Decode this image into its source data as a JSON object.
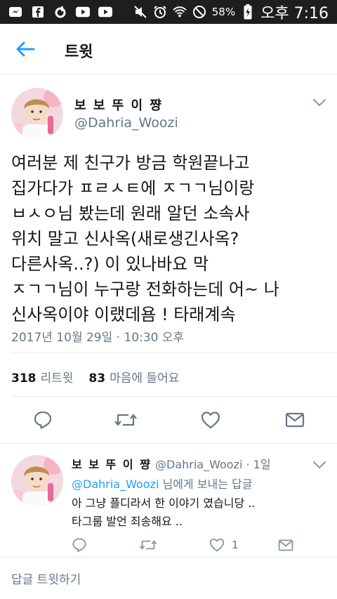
{
  "status_bar": {
    "battery_percent": "58%",
    "time": "오후 7:16",
    "left_icons": [
      "messenger-icon",
      "facebook-icon",
      "kakaostory-icon",
      "youtube-icon",
      "youtube-icon"
    ],
    "right_icons": [
      "mute-icon",
      "alarm-icon",
      "wifi-icon",
      "do-not-disturb-icon",
      "battery-charging-icon"
    ]
  },
  "app_bar": {
    "title": "트윗",
    "back_icon": "arrow-left-icon"
  },
  "main_tweet": {
    "display_name": "보 보 뚜 이 쨩",
    "handle": "@Dahria_Woozi",
    "text_lines": [
      "여러분 제 친구가 방금 학원끝나고",
      "집가다가 ㅍㄹㅅㅌ에 ㅈㄱㄱ님이랑",
      "ㅂㅅㅇ님 봤는데 원래 알던 소속사",
      "위치 말고 신사옥(새로생긴사옥?",
      "다른사옥..?) 이 있나바요 막",
      "ㅈㄱㄱ님이 누구랑 전화하는데 어~ 나",
      "신사옥이야 이랬데욤 ! 타래계속"
    ],
    "timestamp": "2017년 10월 29일 · 10:30 오후",
    "retweet_count": "318",
    "retweet_label": "리트윗",
    "like_count": "83",
    "like_label": "마음에 들어요"
  },
  "reply": {
    "display_name": "보 보 뚜 이 쨩",
    "meta": "@Dahria_Woozi · 1일",
    "mention": "@Dahria_Woozi",
    "reply_to_suffix": " 님에게 보내는 답글",
    "text_lines": [
      "아 그냥 플디라서 한 이야기 였습니당 ..",
      "타그룹 발언 죄송해요 .."
    ],
    "like_count": "1"
  },
  "composer": {
    "placeholder": "답글 트윗하기"
  },
  "colors": {
    "accent": "#1da1f2",
    "secondary_text": "#657786",
    "primary_text": "#14171a",
    "divider": "#e6ecf0",
    "status_bar": "#1e1e1e"
  }
}
